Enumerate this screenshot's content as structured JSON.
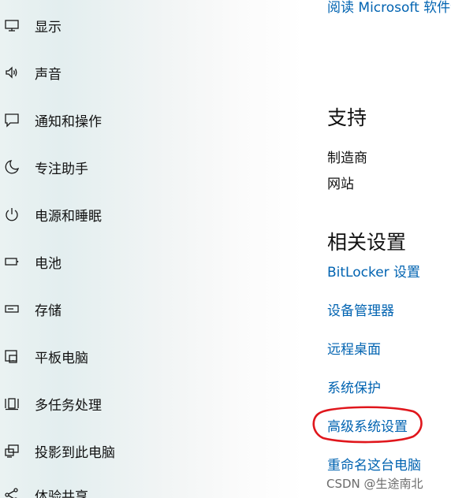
{
  "sidebar": {
    "items": [
      {
        "label": "显示",
        "icon": "monitor-icon"
      },
      {
        "label": "声音",
        "icon": "speaker-icon"
      },
      {
        "label": "通知和操作",
        "icon": "notification-icon"
      },
      {
        "label": "专注助手",
        "icon": "moon-icon"
      },
      {
        "label": "电源和睡眠",
        "icon": "power-icon"
      },
      {
        "label": "电池",
        "icon": "battery-icon"
      },
      {
        "label": "存储",
        "icon": "storage-icon"
      },
      {
        "label": "平板电脑",
        "icon": "tablet-icon"
      },
      {
        "label": "多任务处理",
        "icon": "multitask-icon"
      },
      {
        "label": "投影到此电脑",
        "icon": "project-icon"
      },
      {
        "label": "体验共享",
        "icon": "share-icon"
      }
    ]
  },
  "content": {
    "top_link": "阅读 Microsoft 软件许",
    "support": {
      "heading": "支持",
      "manufacturer": "制造商",
      "website": "网站"
    },
    "related": {
      "heading": "相关设置",
      "links": [
        "BitLocker 设置",
        "设备管理器",
        "远程桌面",
        "系统保护",
        "高级系统设置",
        "重命名这台电脑"
      ]
    }
  },
  "annotation": {
    "highlight_color": "#e0161c"
  },
  "watermark": "CSDN @生途南北",
  "colors": {
    "link": "#0063b1",
    "text": "#111111"
  }
}
